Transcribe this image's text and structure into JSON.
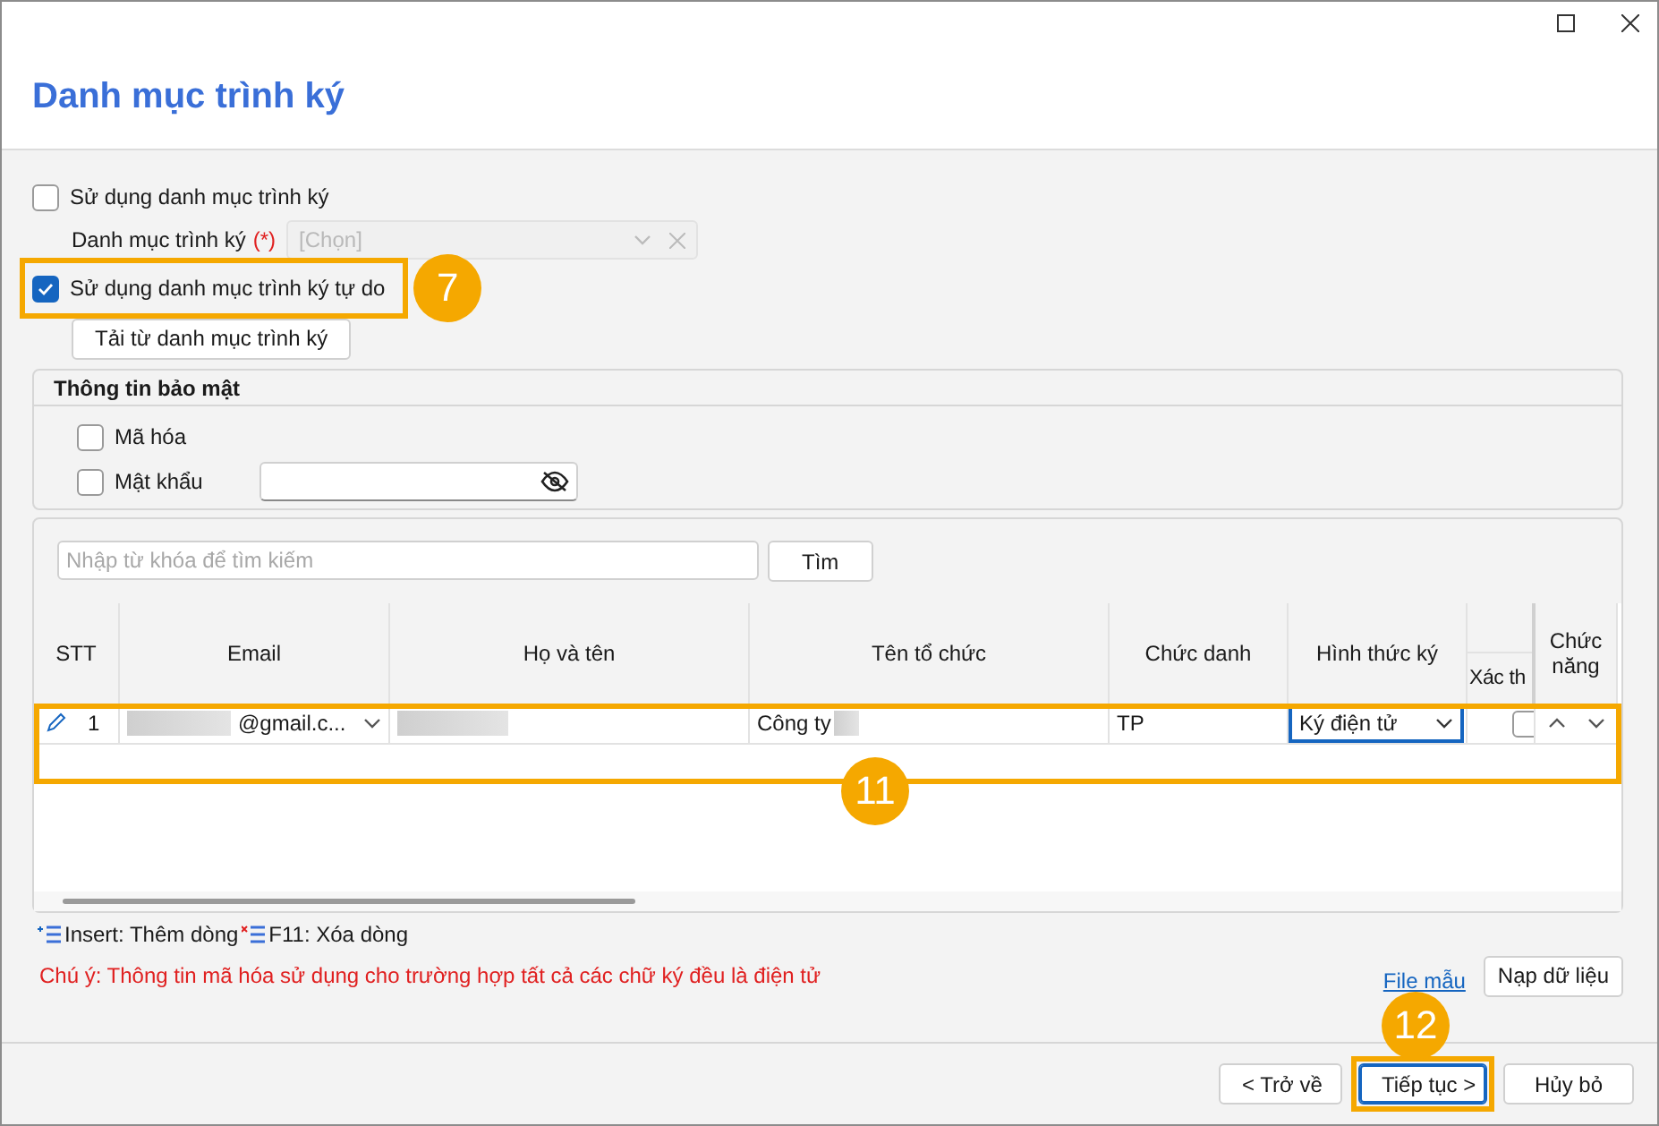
{
  "title": "Danh mục trình ký",
  "use_catalog": {
    "label": "Sử dụng danh mục trình ký",
    "checked": false
  },
  "catalog_field": {
    "label": "Danh mục trình ký",
    "required_mark": "(*)",
    "placeholder": "[Chọn]",
    "disabled": true
  },
  "free_catalog": {
    "label": "Sử dụng danh mục trình ký tự do",
    "checked": true,
    "callout": "7"
  },
  "load_button": "Tải từ danh mục trình ký",
  "security": {
    "title": "Thông tin bảo mật",
    "encrypt": {
      "label": "Mã hóa",
      "checked": false
    },
    "password": {
      "label": "Mật khẩu",
      "checked": false
    }
  },
  "search": {
    "placeholder": "Nhập từ khóa để tìm kiếm",
    "button": "Tìm"
  },
  "table": {
    "columns": [
      {
        "label": "STT"
      },
      {
        "label": "Email"
      },
      {
        "label": "Họ và tên"
      },
      {
        "label": "Tên tổ chức"
      },
      {
        "label": "Chức danh"
      },
      {
        "label": "Hình thức ký"
      },
      {
        "sub_label": "Xác th"
      },
      {
        "label": "Chức năng"
      }
    ],
    "rows": [
      {
        "stt": "1",
        "email": "@gmail.c...",
        "organization": "Công ty",
        "position": "TP",
        "sign_method": "Ký điện tử",
        "verified": false
      }
    ],
    "callout": "11"
  },
  "legend": [
    {
      "kind": "add",
      "text": "Insert: Thêm dòng"
    },
    {
      "kind": "delete",
      "text": "F11: Xóa dòng"
    }
  ],
  "note": "Chú ý: Thông tin mã hóa sử dụng cho trường hợp tất cả các chữ ký đều là điện tử",
  "sample_link": "File mẫu",
  "import_button": "Nạp dữ liệu",
  "footer_buttons": [
    {
      "label": "< Trở về",
      "focused": false
    },
    {
      "label": "Tiếp tục >",
      "focused": true,
      "callout": "12"
    },
    {
      "label": "Hủy bỏ",
      "focused": false
    }
  ]
}
